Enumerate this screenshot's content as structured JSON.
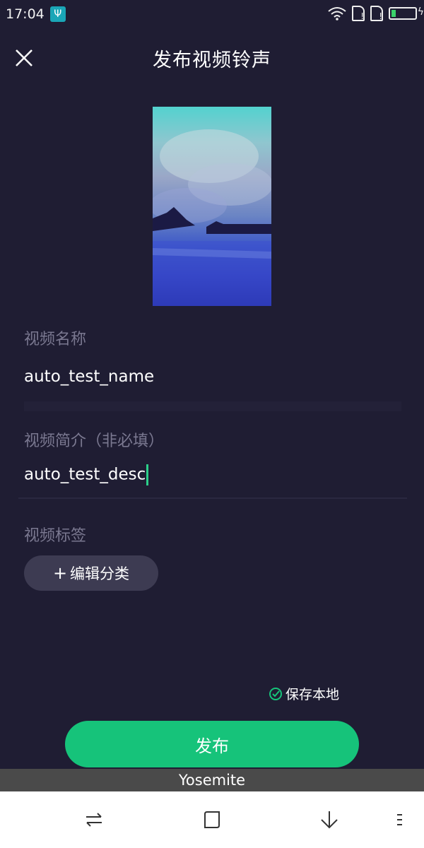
{
  "status": {
    "time": "17:04",
    "usb_icon": "usb-icon",
    "wifi_icon": "wifi-icon",
    "battery_icon": "battery-icon"
  },
  "header": {
    "title": "发布视频铃声",
    "close_icon": "close-icon"
  },
  "form": {
    "name_label": "视频名称",
    "name_value": "auto_test_name",
    "desc_label": "视频简介（非必填）",
    "desc_value": "auto_test_desc",
    "tags_label": "视频标签",
    "edit_category": "编辑分类",
    "plus_glyph": "+"
  },
  "save_local": {
    "label": "保存本地",
    "checked": true
  },
  "publish_label": "发布",
  "tooltip": "Yosemite",
  "colors": {
    "background": "#1f1d33",
    "accent": "#16c37a",
    "muted_text": "#7a7890",
    "chip_bg": "#3d3b52"
  },
  "nav": {
    "switch_icon": "switch-icon",
    "home_icon": "square-icon",
    "down_icon": "arrow-down-icon",
    "menu_icon": "menu-icon"
  }
}
